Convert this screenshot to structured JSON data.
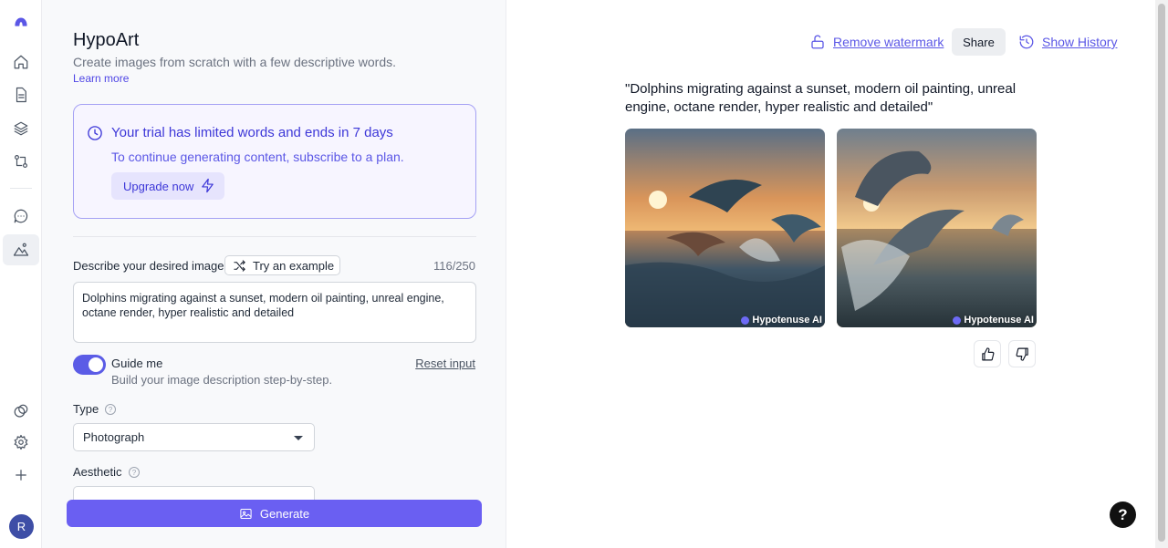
{
  "rail": {
    "items": [
      {
        "name": "logo-icon"
      },
      {
        "name": "home-icon"
      },
      {
        "name": "document-icon"
      },
      {
        "name": "layers-icon"
      },
      {
        "name": "git-compare-icon"
      },
      {
        "name": "chat-icon"
      },
      {
        "name": "image-mountain-icon"
      },
      {
        "name": "integrations-icon"
      },
      {
        "name": "settings-icon"
      },
      {
        "name": "plus-icon"
      }
    ],
    "avatar_initial": "R"
  },
  "panel": {
    "title": "HypoArt",
    "subtitle": "Create images from scratch with a few descriptive words.",
    "learn_more": "Learn more",
    "trial": {
      "title": "Your trial has limited words and ends in 7 days",
      "text": "To continue generating content, subscribe to a plan.",
      "upgrade_label": "Upgrade now"
    },
    "description": {
      "label": "Describe your desired image",
      "try_example": "Try an example",
      "count": "116/250",
      "value": "Dolphins migrating against a sunset, modern oil painting, unreal engine, octane render, hyper realistic and detailed"
    },
    "guide": {
      "title": "Guide me",
      "subtitle": "Build your image description step-by-step.",
      "enabled": true,
      "reset_label": "Reset input"
    },
    "type": {
      "label": "Type",
      "value": "Photograph"
    },
    "aesthetic": {
      "label": "Aesthetic"
    },
    "generate_label": "Generate"
  },
  "results": {
    "remove_watermark": "Remove watermark",
    "share": "Share",
    "show_history": "Show History",
    "prompt": "\"Dolphins migrating against a sunset, modern oil painting, unreal engine, octane render, hyper realistic and detailed\"",
    "watermark_text": "Hypotenuse AI"
  },
  "colors": {
    "accent": "#5b57e6",
    "generate": "#6a5ff2",
    "trial_border": "#a5a1f4"
  }
}
